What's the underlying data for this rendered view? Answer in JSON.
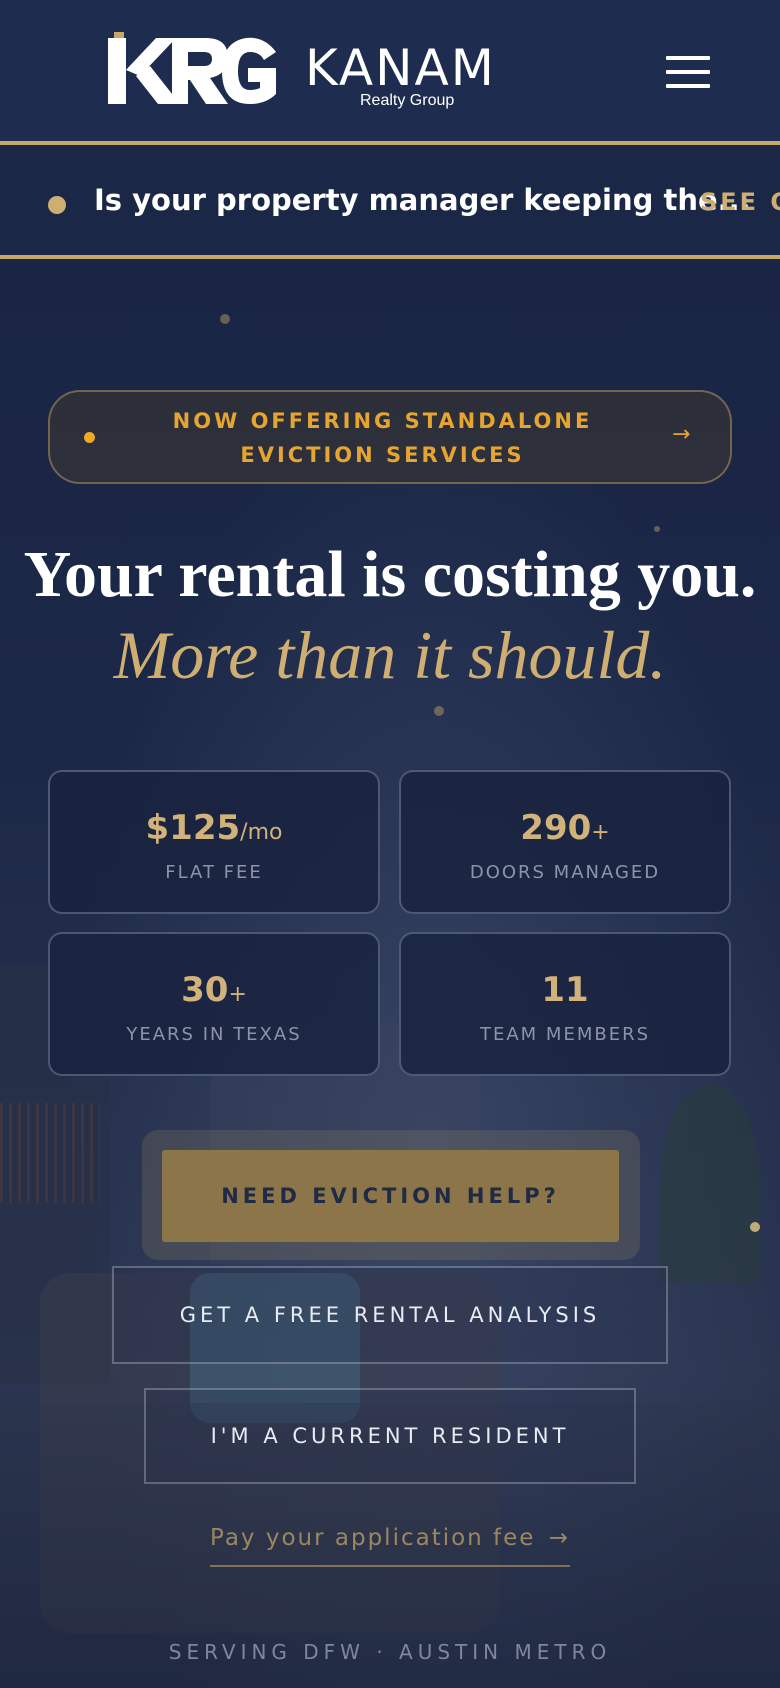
{
  "header": {
    "logo_mark": "KRG",
    "brand_name": "KANAM",
    "brand_sub": "Realty Group",
    "menu_icon": "hamburger-menu-icon"
  },
  "ticker": {
    "text": "Is your property manager keeping the...",
    "link": "SEE O"
  },
  "announcement": {
    "text": "NOW OFFERING STANDALONE EVICTION SERVICES",
    "arrow": "→"
  },
  "headline": {
    "line1": "Your rental is costing you.",
    "line2": "More than it should."
  },
  "stats": [
    {
      "value": "$125",
      "unit": "/mo",
      "label": "FLAT FEE"
    },
    {
      "value": "290",
      "unit": "+",
      "label": "DOORS MANAGED"
    },
    {
      "value": "30",
      "unit": "+",
      "label": "YEARS IN TEXAS"
    },
    {
      "value": "11",
      "unit": "",
      "label": "TEAM MEMBERS"
    }
  ],
  "buttons": {
    "eviction": "NEED EVICTION HELP?",
    "analysis": "GET A FREE RENTAL ANALYSIS",
    "resident": "I'M A CURRENT RESIDENT"
  },
  "pay_link": {
    "text": "Pay your application fee",
    "arrow": "→"
  },
  "footer": {
    "serving": "SERVING DFW · AUSTIN METRO"
  },
  "colors": {
    "navy": "#1e2c4f",
    "gold": "#c9a766",
    "amber": "#e5a530",
    "button_gold": "#8c7548"
  }
}
